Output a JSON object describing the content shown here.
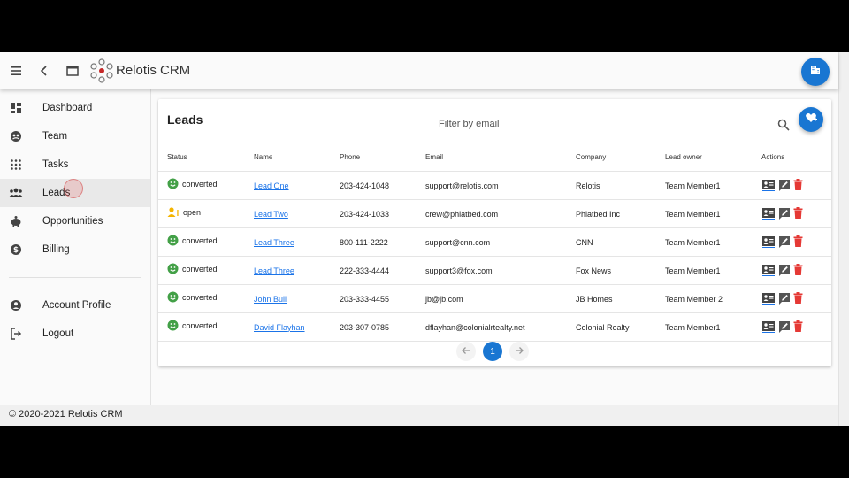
{
  "app": {
    "brand": "Relotis CRM"
  },
  "sidebar": {
    "items": [
      {
        "key": "dashboard",
        "label": "Dashboard",
        "icon": "dashboard-icon",
        "active": false
      },
      {
        "key": "team",
        "label": "Team",
        "icon": "team-icon",
        "active": false
      },
      {
        "key": "tasks",
        "label": "Tasks",
        "icon": "grid-dots-icon",
        "active": false
      },
      {
        "key": "leads",
        "label": "Leads",
        "icon": "people-icon",
        "active": true
      },
      {
        "key": "opportunities",
        "label": "Opportunities",
        "icon": "piggy-bank-icon",
        "active": false
      },
      {
        "key": "billing",
        "label": "Billing",
        "icon": "dollar-icon",
        "active": false
      }
    ],
    "bottom_items": [
      {
        "key": "account-profile",
        "label": "Account Profile",
        "icon": "account-icon"
      },
      {
        "key": "logout",
        "label": "Logout",
        "icon": "logout-icon"
      }
    ]
  },
  "leads": {
    "title": "Leads",
    "filter_placeholder": "Filter by email",
    "columns": [
      "Status",
      "Name",
      "Phone",
      "Email",
      "Company",
      "Lead owner",
      "Actions"
    ],
    "rows": [
      {
        "status": "converted",
        "name": "Lead One",
        "phone": "203-424-1048",
        "email": "support@relotis.com",
        "company": "Relotis",
        "owner": "Team Member1"
      },
      {
        "status": "open",
        "name": "Lead Two",
        "phone": "203-424-1033",
        "email": "crew@phlatbed.com",
        "company": "Phlatbed Inc",
        "owner": "Team Member1"
      },
      {
        "status": "converted",
        "name": "Lead Three",
        "phone": "800-111-2222",
        "email": "support@cnn.com",
        "company": "CNN",
        "owner": "Team Member1"
      },
      {
        "status": "converted",
        "name": "Lead Three",
        "phone": "222-333-4444",
        "email": "support3@fox.com",
        "company": "Fox News",
        "owner": "Team Member1"
      },
      {
        "status": "converted",
        "name": "John Bull",
        "phone": "203-333-4455",
        "email": "jb@jb.com",
        "company": "JB Homes",
        "owner": "Team Member 2"
      },
      {
        "status": "converted",
        "name": "David Flayhan",
        "phone": "203-307-0785",
        "email": "dflayhan@colonialrtealty.net",
        "company": "Colonial Realty",
        "owner": "Team Member1"
      }
    ],
    "pagination": {
      "current_page": "1"
    }
  },
  "footer": {
    "text": "© 2020-2021 Relotis CRM"
  },
  "colors": {
    "accent": "#1976d2",
    "converted": "#43a047",
    "open": "#f4b400",
    "delete": "#e53935",
    "link": "#1a73e8"
  }
}
